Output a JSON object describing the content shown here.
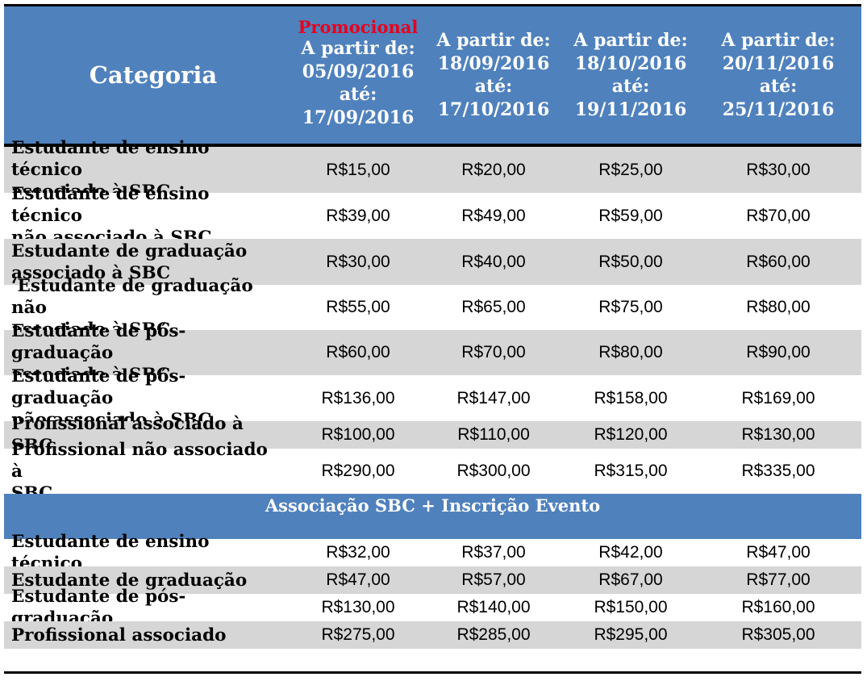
{
  "header": {
    "category_label": "Categoria",
    "promo_label": "Promocional",
    "columns": [
      {
        "line1": "A partir de:",
        "line2": "05/09/2016",
        "line3": "até:",
        "line4": "17/09/2016"
      },
      {
        "line1": "A partir de:",
        "line2": "18/09/2016",
        "line3": "até:",
        "line4": "17/10/2016"
      },
      {
        "line1": "A partir de:",
        "line2": "18/10/2016",
        "line3": "até:",
        "line4": "19/11/2016"
      },
      {
        "line1": "A partir de:",
        "line2": "20/11/2016",
        "line3": "até:",
        "line4": "25/11/2016"
      }
    ]
  },
  "rows": [
    {
      "line1": "Estudante de ensino técnico",
      "line2": "associado à SBC",
      "prices": [
        "R$15,00",
        "R$20,00",
        "R$25,00",
        "R$30,00"
      ]
    },
    {
      "line1": "Estudante de ensino técnico",
      "line2": "não associado à SBC",
      "prices": [
        "R$39,00",
        "R$49,00",
        "R$59,00",
        "R$70,00"
      ]
    },
    {
      "line1": "Estudante de graduação",
      "line2": "associado à SBC",
      "prices": [
        "R$30,00",
        "R$40,00",
        "R$50,00",
        "R$60,00"
      ]
    },
    {
      "line1": "‘Estudante de graduação não",
      "line2": "associado à SBC",
      "prices": [
        "R$55,00",
        "R$65,00",
        "R$75,00",
        "R$80,00"
      ]
    },
    {
      "line1": "Estudante de pós-graduação",
      "line2": "associado à SBC",
      "prices": [
        "R$60,00",
        "R$70,00",
        "R$80,00",
        "R$90,00"
      ]
    },
    {
      "line1": "Estudante de pós-graduação",
      "line2": "não associado à SBC",
      "prices": [
        "R$136,00",
        "R$147,00",
        "R$158,00",
        "R$169,00"
      ]
    },
    {
      "line1": "Profissional associado à SBC",
      "line2": "",
      "prices": [
        "R$100,00",
        "R$110,00",
        "R$120,00",
        "R$130,00"
      ]
    },
    {
      "line1": "Profissional não associado à",
      "line2": "SBC",
      "prices": [
        "R$290,00",
        "R$300,00",
        "R$315,00",
        "R$335,00"
      ]
    }
  ],
  "section": {
    "title": "Associação SBC + Inscrição Evento"
  },
  "section_rows": [
    {
      "label": "Estudante de ensino técnico",
      "prices": [
        "R$32,00",
        "R$37,00",
        "R$42,00",
        "R$47,00"
      ]
    },
    {
      "label": "Estudante de graduação",
      "prices": [
        "R$47,00",
        "R$57,00",
        "R$67,00",
        "R$77,00"
      ]
    },
    {
      "label": "Estudante de pós-graduação",
      "prices": [
        "R$130,00",
        "R$140,00",
        "R$150,00",
        "R$160,00"
      ]
    },
    {
      "label": "Profissional associado",
      "prices": [
        "R$275,00",
        "R$285,00",
        "R$295,00",
        "R$305,00"
      ]
    }
  ],
  "colors": {
    "header_bg": "#4f81bd",
    "promo_text": "#e8001b",
    "row_alt_bg": "#d6d6d6"
  }
}
